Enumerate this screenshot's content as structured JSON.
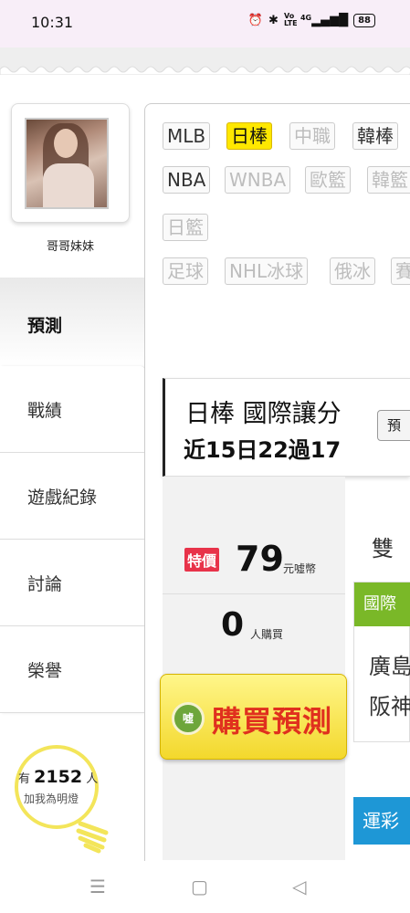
{
  "status_bar": {
    "time": "10:31",
    "icons": [
      "alarm-icon",
      "bluetooth-icon",
      "volte-icon",
      "4g-signal-icon"
    ],
    "network": "4G",
    "volte": "Vo LTE",
    "battery": "88"
  },
  "profile": {
    "name": "哥哥妹妹"
  },
  "menu": {
    "active": "預測",
    "items": [
      "戰績",
      "遊戲紀錄",
      "討論",
      "榮譽"
    ]
  },
  "fans": {
    "prefix": "有",
    "count": "2152",
    "suffix": "人",
    "note": "加我為明燈"
  },
  "tags": {
    "row1": [
      "MLB",
      "日棒",
      "中職",
      "韓棒"
    ],
    "row2": [
      "NBA",
      "WNBA",
      "歐籃",
      "韓籃"
    ],
    "row3": [
      "日籃"
    ],
    "row4": [
      "足球",
      "NHL冰球",
      "俄冰",
      "賽"
    ],
    "active": "日棒"
  },
  "info": {
    "title": "日棒 國際讓分",
    "record": "近15日22過17",
    "button": "預測"
  },
  "pricing": {
    "badge": "特價",
    "price": "79",
    "unit": "元噓幣",
    "buyers": "0",
    "buyers_unit": "人購買",
    "buy_label": "購買預測",
    "buy_icon_text": "噓"
  },
  "match": {
    "header": "雙",
    "type": "國際",
    "team1": "廣島",
    "team2": "阪神",
    "lottery": "運彩"
  },
  "colors": {
    "active_tag": "#ffe800",
    "sale_red": "#e8334a",
    "buy_yellow": "#f3d82c",
    "intl_green": "#7ab828",
    "lottery_blue": "#1e97d6"
  }
}
